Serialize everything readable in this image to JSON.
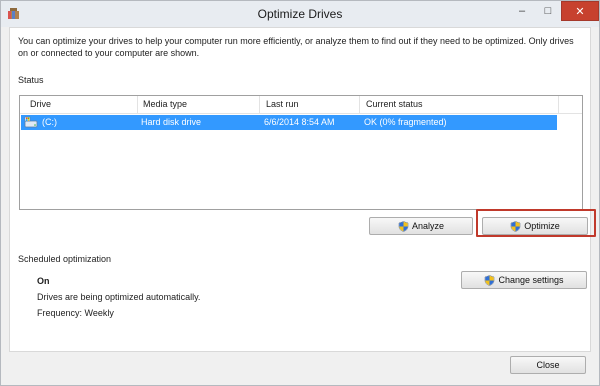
{
  "window": {
    "title": "Optimize Drives",
    "controls": {
      "minimize": "–",
      "maximize": "□",
      "close": "✕"
    }
  },
  "description": "You can optimize your drives to help your computer run more efficiently, or analyze them to find out if they need to be optimized. Only drives on or connected to your computer are shown.",
  "status": {
    "label": "Status",
    "columns": [
      "Drive",
      "Media type",
      "Last run",
      "Current status"
    ],
    "rows": [
      {
        "drive": "(C:)",
        "media_type": "Hard disk drive",
        "last_run": "6/6/2014 8:54 AM",
        "current_status": "OK (0% fragmented)",
        "selected": true
      }
    ]
  },
  "buttons": {
    "analyze": "Analyze",
    "optimize": "Optimize",
    "change_settings": "Change settings",
    "close": "Close"
  },
  "scheduled": {
    "label": "Scheduled optimization",
    "state": "On",
    "detail": "Drives are being optimized automatically.",
    "frequency": "Frequency: Weekly"
  },
  "colors": {
    "selection": "#3399ff",
    "highlight_box": "#c0392b",
    "close_button": "#c7412e"
  },
  "icons": {
    "app": "defrag-app-icon",
    "drive": "hard-drive-icon",
    "uac": "uac-shield-icon"
  }
}
